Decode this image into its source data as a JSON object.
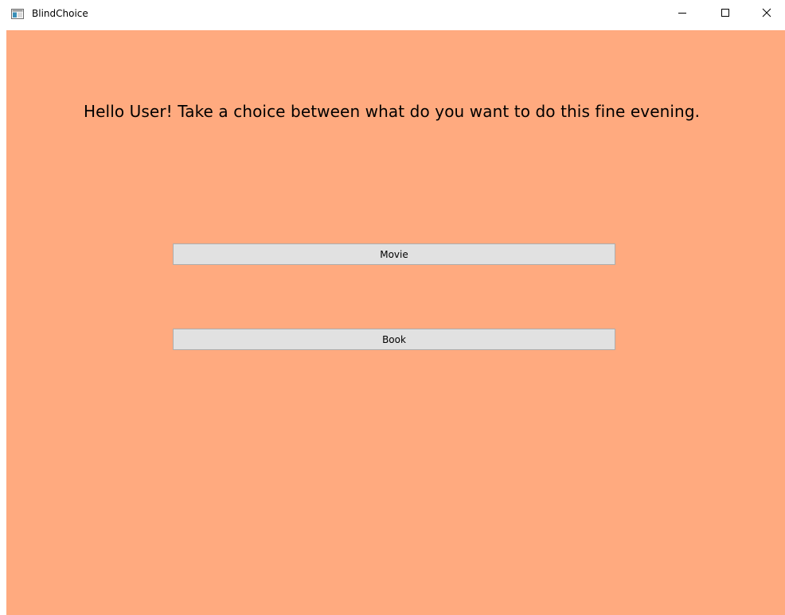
{
  "window": {
    "title": "BlindChoice",
    "icons": {
      "app": "app-window-icon",
      "minimize": "minimize-icon",
      "maximize": "maximize-icon",
      "close": "close-icon"
    }
  },
  "main": {
    "greeting": "Hello User! Take a choice between what do you want to do this fine evening.",
    "buttons": {
      "movie": "Movie",
      "book": "Book"
    }
  },
  "colors": {
    "background": "#ffaa7f",
    "button": "#e1e1e1",
    "button_border": "#adadad"
  }
}
